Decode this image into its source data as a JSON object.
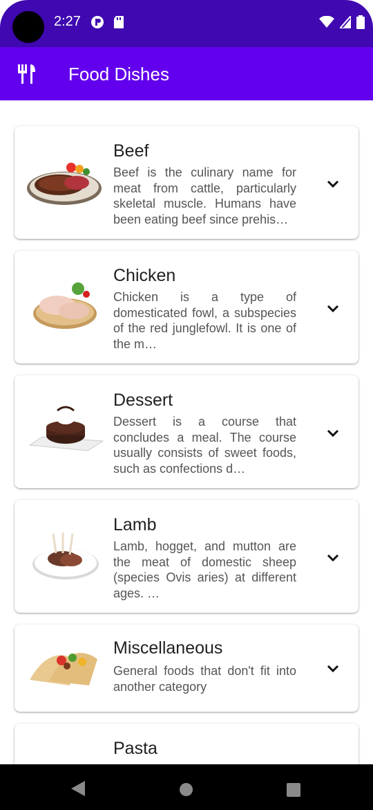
{
  "status_bar": {
    "time": "2:27",
    "color": "#3f08b0"
  },
  "appbar": {
    "title": "Food Dishes",
    "icon": "restaurant-icon",
    "color": "#6200ee"
  },
  "cards": [
    {
      "title": "Beef",
      "description": "Beef is the culinary name for meat from cattle, particularly skeletal muscle. Humans have been eating beef since prehis…",
      "image": "steak-plate-image"
    },
    {
      "title": "Chicken",
      "description": "Chicken is a type of domesticated fowl, a subspecies of the red junglefowl. It is one of the m…",
      "image": "raw-chicken-plate-image"
    },
    {
      "title": "Dessert",
      "description": "Dessert is a course that concludes a meal. The course usually consists of sweet foods, such as confections d…",
      "image": "chocolate-cake-image"
    },
    {
      "title": "Lamb",
      "description": "Lamb, hogget, and mutton are the meat of domestic sheep (species Ovis aries) at different ages. …",
      "image": "lamb-chops-image"
    },
    {
      "title": "Miscellaneous",
      "description": "General foods that don't fit into another category",
      "image": "tacos-image"
    },
    {
      "title": "Pasta",
      "description": "",
      "image": "pasta-image"
    }
  ]
}
